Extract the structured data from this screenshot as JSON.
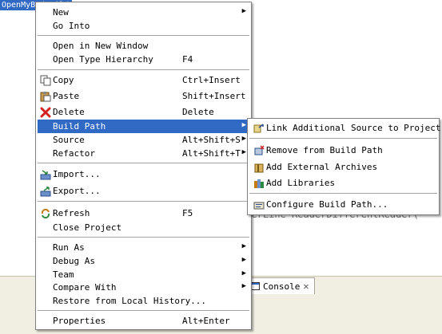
{
  "background": {
    "project_label": "OpenMyBadBuild",
    "editor_fragment": "rderLine ReaderDifferentReader(",
    "console_tab": "Console",
    "console_close": "✕"
  },
  "menu": {
    "items": [
      {
        "label": "New",
        "accel": "",
        "has_submenu": true,
        "icon": null
      },
      {
        "label": "Go Into",
        "accel": "",
        "has_submenu": false,
        "icon": null
      },
      {
        "label": "Open in New Window",
        "accel": "",
        "has_submenu": false,
        "icon": null
      },
      {
        "label": "Open Type Hierarchy",
        "accel": "F4",
        "has_submenu": false,
        "icon": null
      },
      {
        "label": "Copy",
        "accel": "Ctrl+Insert",
        "has_submenu": false,
        "icon": "copy-icon"
      },
      {
        "label": "Paste",
        "accel": "Shift+Insert",
        "has_submenu": false,
        "icon": "paste-icon"
      },
      {
        "label": "Delete",
        "accel": "Delete",
        "has_submenu": false,
        "icon": "delete-icon"
      },
      {
        "label": "Build Path",
        "accel": "",
        "has_submenu": true,
        "icon": null,
        "highlighted": true
      },
      {
        "label": "Source",
        "accel": "Alt+Shift+S",
        "has_submenu": true,
        "icon": null
      },
      {
        "label": "Refactor",
        "accel": "Alt+Shift+T",
        "has_submenu": true,
        "icon": null
      },
      {
        "label": "Import...",
        "accel": "",
        "has_submenu": false,
        "icon": "import-icon"
      },
      {
        "label": "Export...",
        "accel": "",
        "has_submenu": false,
        "icon": "export-icon"
      },
      {
        "label": "Refresh",
        "accel": "F5",
        "has_submenu": false,
        "icon": "refresh-icon"
      },
      {
        "label": "Close Project",
        "accel": "",
        "has_submenu": false,
        "icon": null
      },
      {
        "label": "Run As",
        "accel": "",
        "has_submenu": true,
        "icon": null
      },
      {
        "label": "Debug As",
        "accel": "",
        "has_submenu": true,
        "icon": null
      },
      {
        "label": "Team",
        "accel": "",
        "has_submenu": true,
        "icon": null
      },
      {
        "label": "Compare With",
        "accel": "",
        "has_submenu": true,
        "icon": null
      },
      {
        "label": "Restore from Local History...",
        "accel": "",
        "has_submenu": false,
        "icon": null
      },
      {
        "label": "Properties",
        "accel": "Alt+Enter",
        "has_submenu": false,
        "icon": null
      }
    ],
    "submenu_arrow": "▶"
  },
  "submenu": {
    "items": [
      {
        "label": "Link Additional Source to Project",
        "icon": "link-source-icon"
      },
      {
        "label": "Remove from Build Path",
        "icon": "remove-path-icon"
      },
      {
        "label": "Add External Archives",
        "icon": "add-archive-icon"
      },
      {
        "label": "Add Libraries",
        "icon": "add-library-icon"
      },
      {
        "label": "Configure Build Path...",
        "icon": "configure-path-icon"
      }
    ]
  },
  "colors": {
    "highlight": "#316ac5",
    "delete_red": "#d32020"
  }
}
